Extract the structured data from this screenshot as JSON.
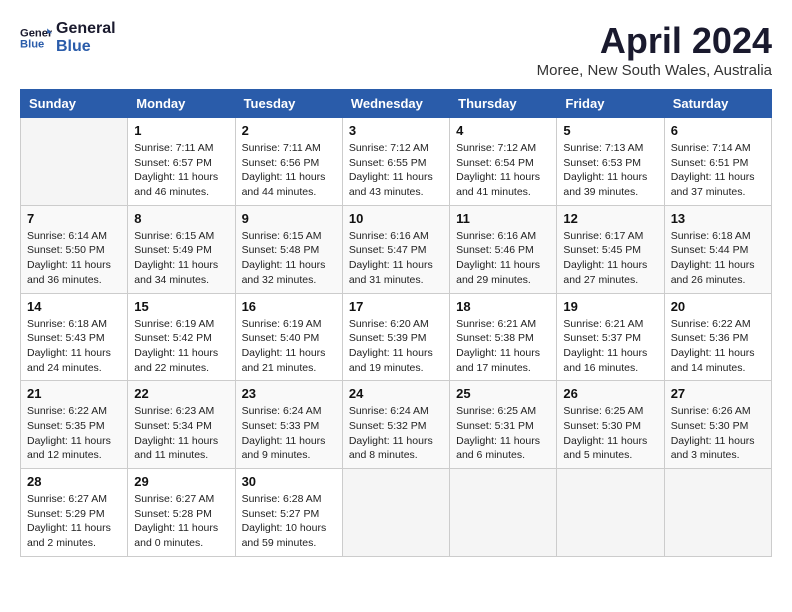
{
  "logo": {
    "line1": "General",
    "line2": "Blue"
  },
  "title": "April 2024",
  "location": "Moree, New South Wales, Australia",
  "days_of_week": [
    "Sunday",
    "Monday",
    "Tuesday",
    "Wednesday",
    "Thursday",
    "Friday",
    "Saturday"
  ],
  "weeks": [
    [
      {
        "day": "",
        "info": ""
      },
      {
        "day": "1",
        "info": "Sunrise: 7:11 AM\nSunset: 6:57 PM\nDaylight: 11 hours\nand 46 minutes."
      },
      {
        "day": "2",
        "info": "Sunrise: 7:11 AM\nSunset: 6:56 PM\nDaylight: 11 hours\nand 44 minutes."
      },
      {
        "day": "3",
        "info": "Sunrise: 7:12 AM\nSunset: 6:55 PM\nDaylight: 11 hours\nand 43 minutes."
      },
      {
        "day": "4",
        "info": "Sunrise: 7:12 AM\nSunset: 6:54 PM\nDaylight: 11 hours\nand 41 minutes."
      },
      {
        "day": "5",
        "info": "Sunrise: 7:13 AM\nSunset: 6:53 PM\nDaylight: 11 hours\nand 39 minutes."
      },
      {
        "day": "6",
        "info": "Sunrise: 7:14 AM\nSunset: 6:51 PM\nDaylight: 11 hours\nand 37 minutes."
      }
    ],
    [
      {
        "day": "7",
        "info": "Sunrise: 6:14 AM\nSunset: 5:50 PM\nDaylight: 11 hours\nand 36 minutes."
      },
      {
        "day": "8",
        "info": "Sunrise: 6:15 AM\nSunset: 5:49 PM\nDaylight: 11 hours\nand 34 minutes."
      },
      {
        "day": "9",
        "info": "Sunrise: 6:15 AM\nSunset: 5:48 PM\nDaylight: 11 hours\nand 32 minutes."
      },
      {
        "day": "10",
        "info": "Sunrise: 6:16 AM\nSunset: 5:47 PM\nDaylight: 11 hours\nand 31 minutes."
      },
      {
        "day": "11",
        "info": "Sunrise: 6:16 AM\nSunset: 5:46 PM\nDaylight: 11 hours\nand 29 minutes."
      },
      {
        "day": "12",
        "info": "Sunrise: 6:17 AM\nSunset: 5:45 PM\nDaylight: 11 hours\nand 27 minutes."
      },
      {
        "day": "13",
        "info": "Sunrise: 6:18 AM\nSunset: 5:44 PM\nDaylight: 11 hours\nand 26 minutes."
      }
    ],
    [
      {
        "day": "14",
        "info": "Sunrise: 6:18 AM\nSunset: 5:43 PM\nDaylight: 11 hours\nand 24 minutes."
      },
      {
        "day": "15",
        "info": "Sunrise: 6:19 AM\nSunset: 5:42 PM\nDaylight: 11 hours\nand 22 minutes."
      },
      {
        "day": "16",
        "info": "Sunrise: 6:19 AM\nSunset: 5:40 PM\nDaylight: 11 hours\nand 21 minutes."
      },
      {
        "day": "17",
        "info": "Sunrise: 6:20 AM\nSunset: 5:39 PM\nDaylight: 11 hours\nand 19 minutes."
      },
      {
        "day": "18",
        "info": "Sunrise: 6:21 AM\nSunset: 5:38 PM\nDaylight: 11 hours\nand 17 minutes."
      },
      {
        "day": "19",
        "info": "Sunrise: 6:21 AM\nSunset: 5:37 PM\nDaylight: 11 hours\nand 16 minutes."
      },
      {
        "day": "20",
        "info": "Sunrise: 6:22 AM\nSunset: 5:36 PM\nDaylight: 11 hours\nand 14 minutes."
      }
    ],
    [
      {
        "day": "21",
        "info": "Sunrise: 6:22 AM\nSunset: 5:35 PM\nDaylight: 11 hours\nand 12 minutes."
      },
      {
        "day": "22",
        "info": "Sunrise: 6:23 AM\nSunset: 5:34 PM\nDaylight: 11 hours\nand 11 minutes."
      },
      {
        "day": "23",
        "info": "Sunrise: 6:24 AM\nSunset: 5:33 PM\nDaylight: 11 hours\nand 9 minutes."
      },
      {
        "day": "24",
        "info": "Sunrise: 6:24 AM\nSunset: 5:32 PM\nDaylight: 11 hours\nand 8 minutes."
      },
      {
        "day": "25",
        "info": "Sunrise: 6:25 AM\nSunset: 5:31 PM\nDaylight: 11 hours\nand 6 minutes."
      },
      {
        "day": "26",
        "info": "Sunrise: 6:25 AM\nSunset: 5:30 PM\nDaylight: 11 hours\nand 5 minutes."
      },
      {
        "day": "27",
        "info": "Sunrise: 6:26 AM\nSunset: 5:30 PM\nDaylight: 11 hours\nand 3 minutes."
      }
    ],
    [
      {
        "day": "28",
        "info": "Sunrise: 6:27 AM\nSunset: 5:29 PM\nDaylight: 11 hours\nand 2 minutes."
      },
      {
        "day": "29",
        "info": "Sunrise: 6:27 AM\nSunset: 5:28 PM\nDaylight: 11 hours\nand 0 minutes."
      },
      {
        "day": "30",
        "info": "Sunrise: 6:28 AM\nSunset: 5:27 PM\nDaylight: 10 hours\nand 59 minutes."
      },
      {
        "day": "",
        "info": ""
      },
      {
        "day": "",
        "info": ""
      },
      {
        "day": "",
        "info": ""
      },
      {
        "day": "",
        "info": ""
      }
    ]
  ]
}
